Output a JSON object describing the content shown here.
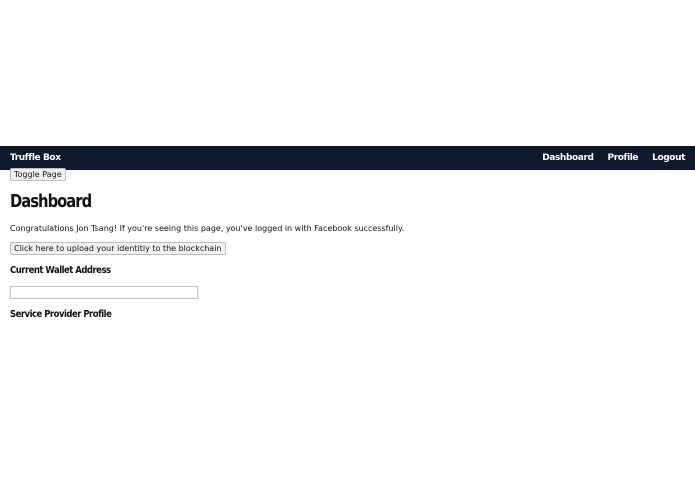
{
  "navbar": {
    "brand": "Truffle Box",
    "links": [
      {
        "label": "Dashboard"
      },
      {
        "label": "Profile"
      },
      {
        "label": "Logout"
      }
    ],
    "background": "#0e1a2b"
  },
  "main": {
    "toggle_button": "Toggle Page",
    "title": "Dashboard",
    "congrats_text": "Congratulations Jon Tsang! If you're seeing this page, you've logged in with Facebook successfully.",
    "upload_button": "Click here to upload your identitiy to the blockchain",
    "wallet_heading": "Current Wallet Address",
    "wallet_value": "",
    "provider_heading": "Service Provider Profile"
  }
}
